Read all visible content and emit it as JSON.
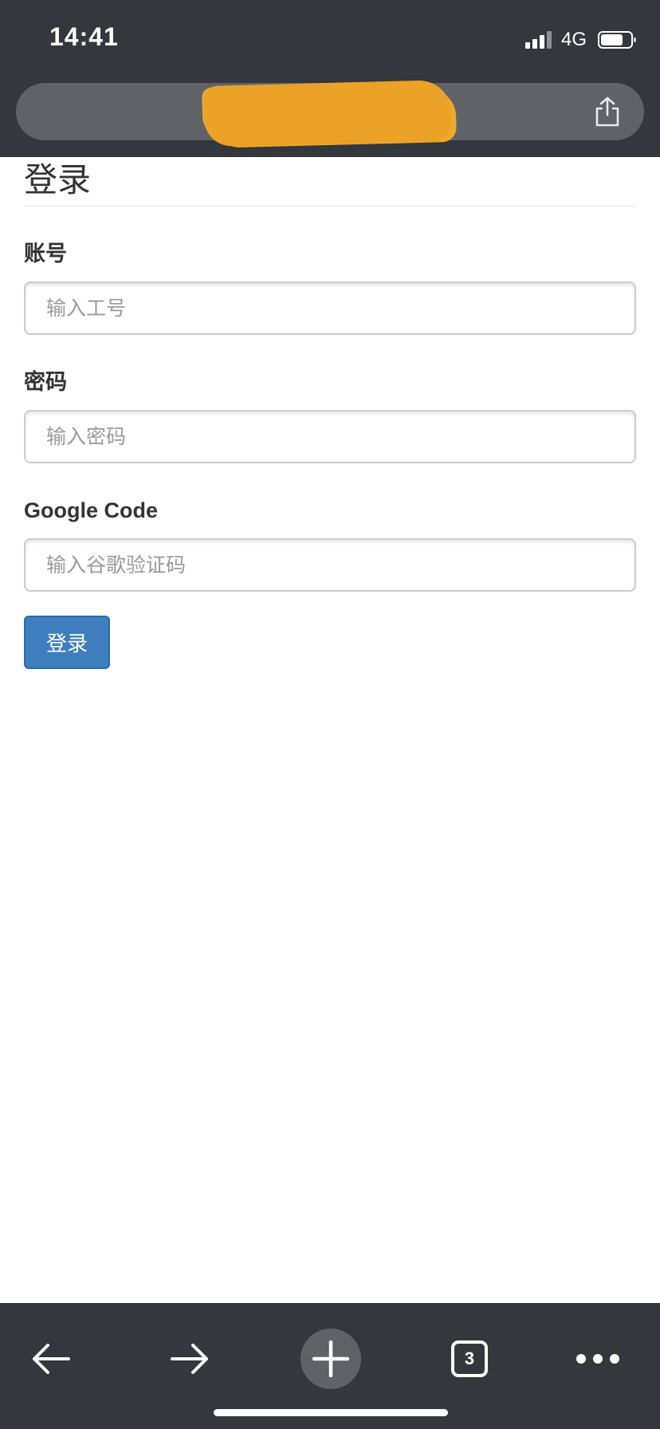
{
  "status_bar": {
    "time": "14:41",
    "network": "4G",
    "battery_level": 0.75,
    "signal_bars_filled": 3
  },
  "address_bar": {
    "url_redacted": true,
    "redaction_color": "#f4a623"
  },
  "form": {
    "title": "登录",
    "account": {
      "label": "账号",
      "placeholder": "输入工号",
      "value": ""
    },
    "password": {
      "label": "密码",
      "placeholder": "输入密码",
      "value": ""
    },
    "google_code": {
      "label": "Google Code",
      "placeholder": "输入谷歌验证码",
      "value": ""
    },
    "submit_label": "登录"
  },
  "toolbar": {
    "tab_count": "3",
    "icons": [
      "back-arrow-icon",
      "forward-arrow-icon",
      "plus-icon",
      "tabs-icon",
      "more-icon"
    ]
  },
  "colors": {
    "chrome_background": "#34373b",
    "url_bar_background": "#5f6368",
    "primary_button": "#3f7ebe",
    "text": "#333333",
    "input_border": "#cccccc"
  }
}
